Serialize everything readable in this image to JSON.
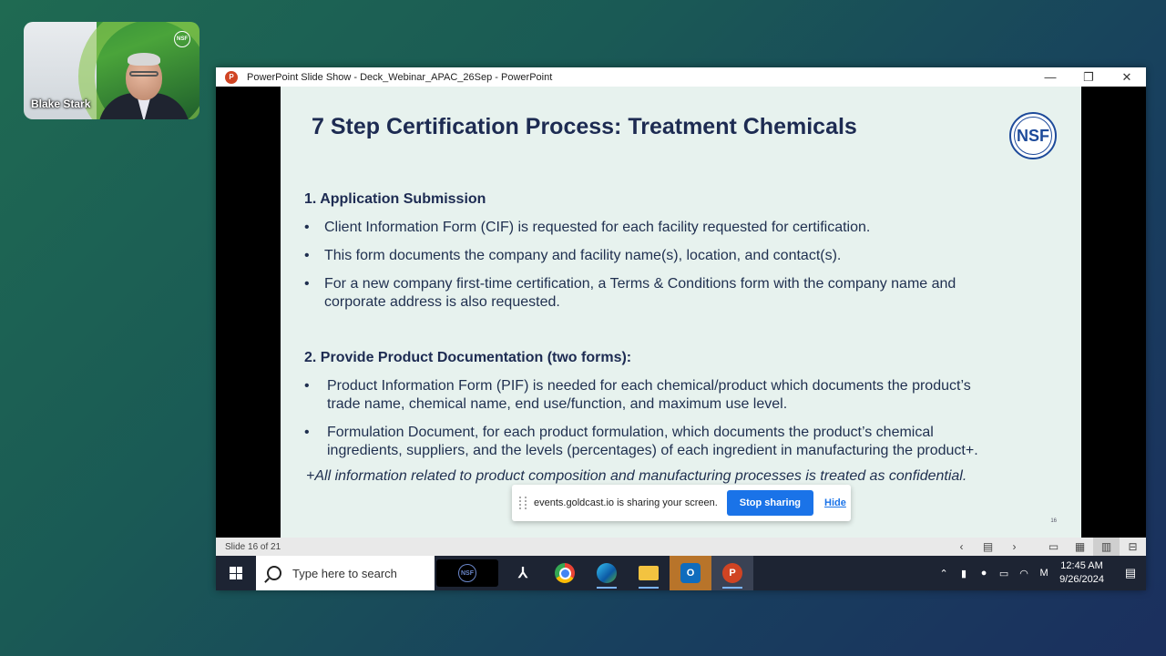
{
  "webcam": {
    "name": "Blake Stark",
    "logo": "NSF"
  },
  "window": {
    "title": "PowerPoint Slide Show  -  Deck_Webinar_APAC_26Sep - PowerPoint",
    "app_icon": "P",
    "controls": {
      "minimize": "—",
      "restore": "❐",
      "close": "✕"
    }
  },
  "slide": {
    "title": "7 Step Certification Process: Treatment Chemicals",
    "logo": "NSF",
    "section1": {
      "heading": "1. Application Submission",
      "bullets": [
        "Client Information Form (CIF) is requested for each facility requested for certification.",
        "This form documents the company and facility name(s), location, and contact(s).",
        "For a new company first-time certification, a Terms & Conditions form with the company name and",
        "corporate address is also requested."
      ]
    },
    "section2": {
      "heading": "2.  Provide Product  Documentation (two forms):",
      "bullets": [
        "Product Information Form (PIF) is needed for each chemical/product which documents the product’s",
        "trade name, chemical name, end use/function, and maximum use level.",
        "Formulation Document, for each product formulation, which documents the product’s chemical",
        "ingredients, suppliers, and the levels (percentages) of each ingredient in manufacturing the product+."
      ]
    },
    "footnote": "+All information related to product composition and manufacturing processes is treated as confidential.",
    "number": "16",
    "bullet_char": "•"
  },
  "share_bar": {
    "message": "events.goldcast.io is sharing your screen.",
    "stop_label": "Stop sharing",
    "hide_label": "Hide"
  },
  "statusbar": {
    "slide_info": "Slide 16 of 21",
    "icons": [
      "prev-icon",
      "slide-sorter-icon",
      "next-icon",
      "notes-icon",
      "grid-icon",
      "reading-view-icon",
      "presenter-icon"
    ]
  },
  "taskbar": {
    "search_placeholder": "Type here to search",
    "nsf_label": "NSF",
    "time": "12:45 AM",
    "date": "9/26/2024"
  }
}
